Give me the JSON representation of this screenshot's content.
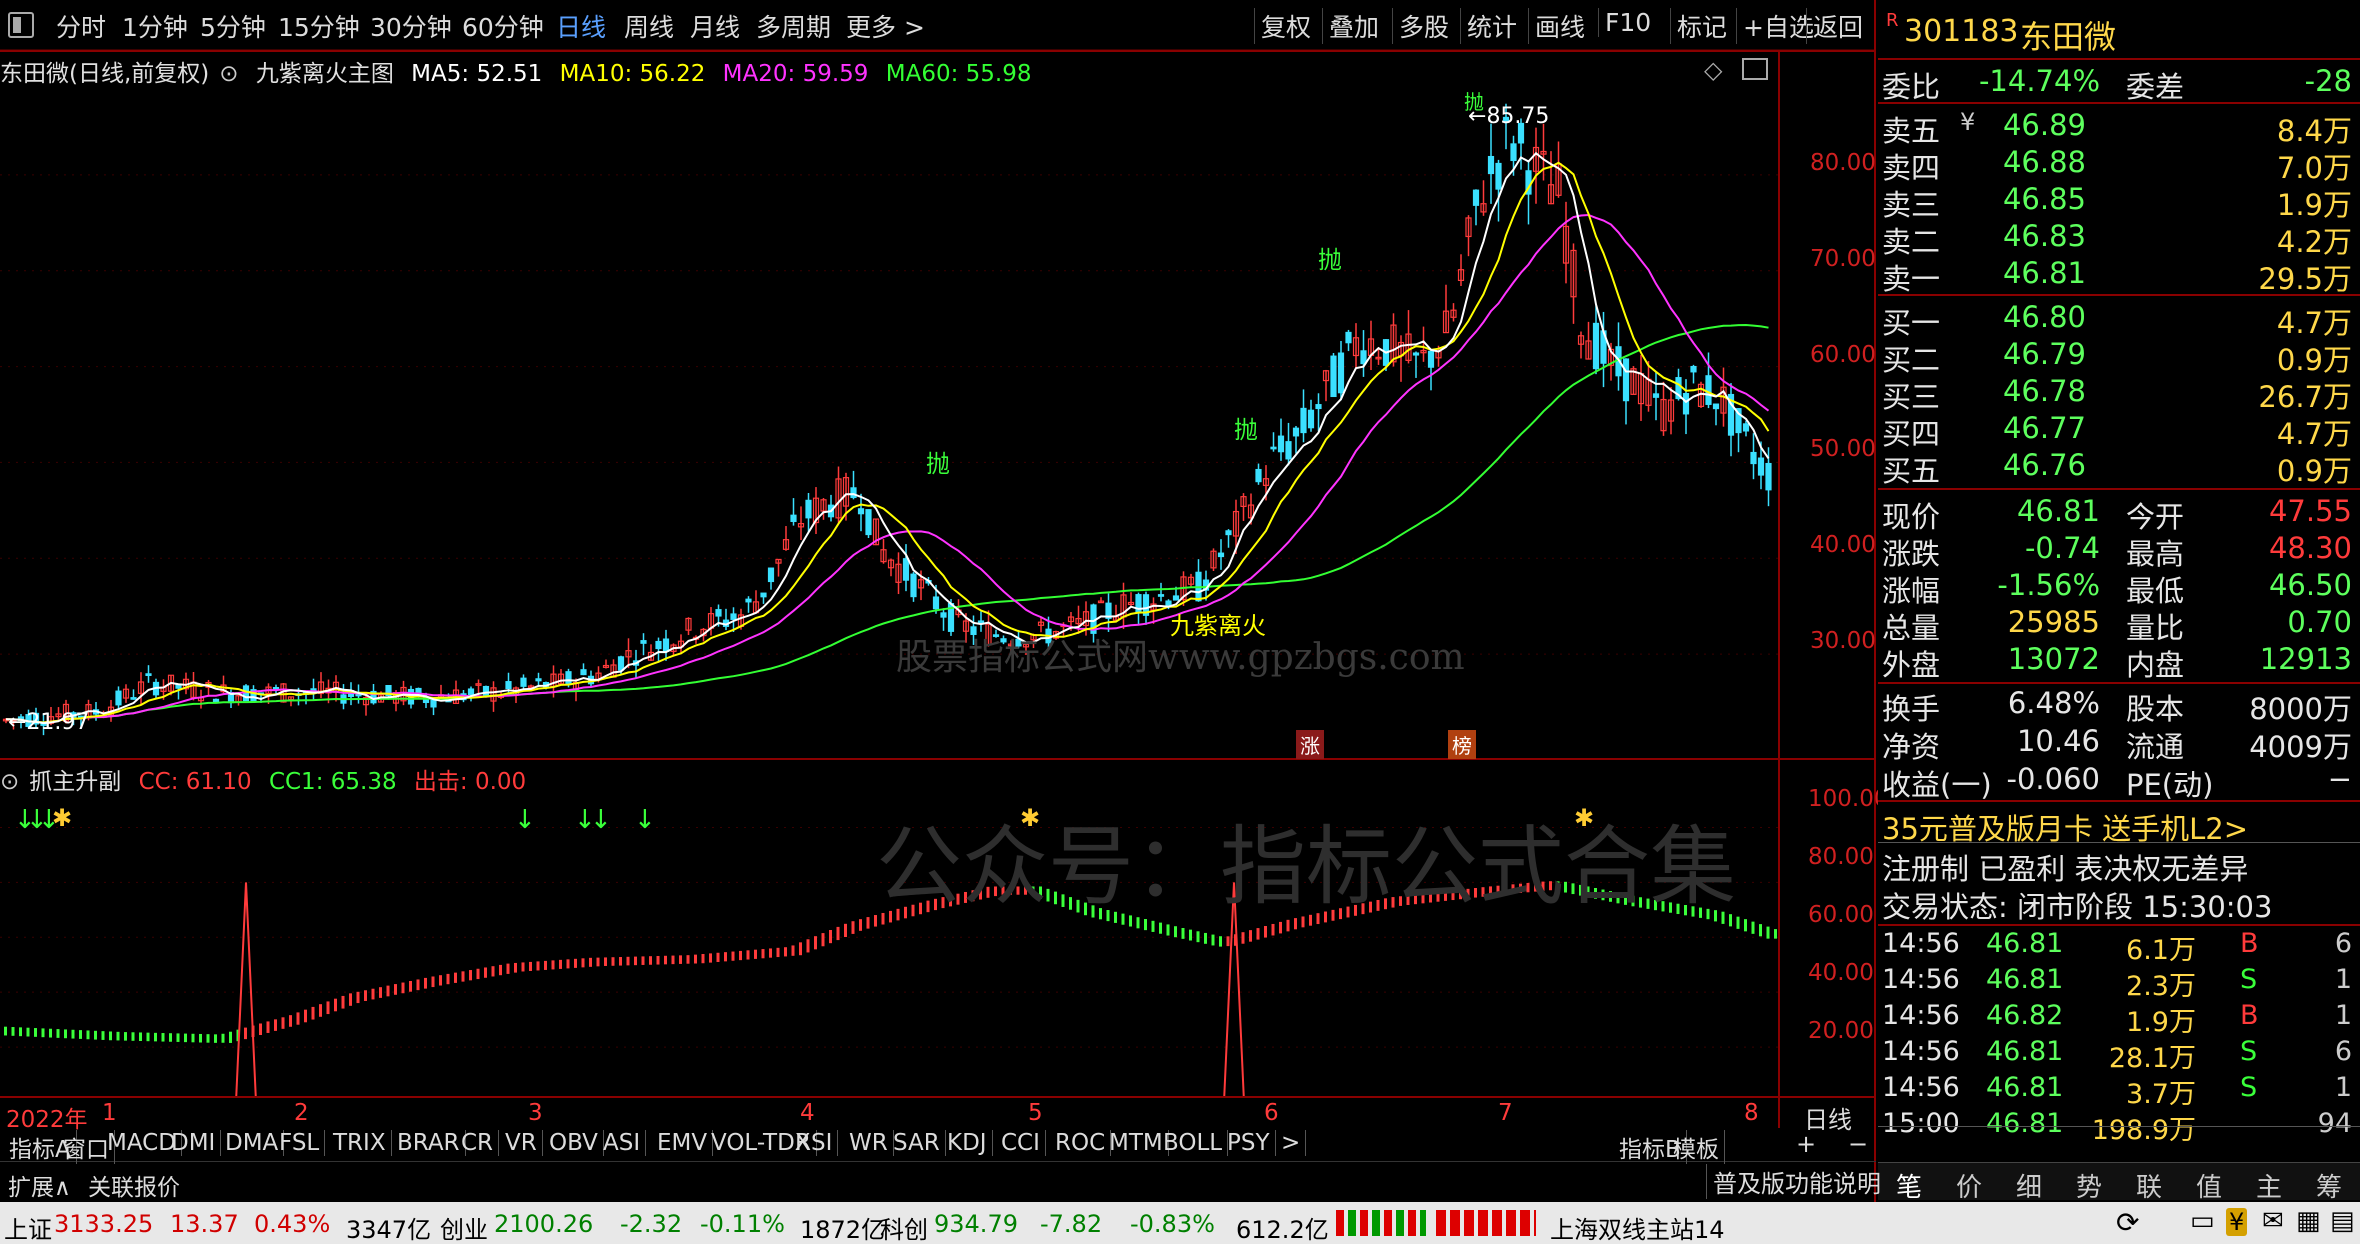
{
  "toolbar": {
    "periods": [
      "分时",
      "1分钟",
      "5分钟",
      "15分钟",
      "30分钟",
      "60分钟",
      "日线",
      "周线",
      "月线",
      "多周期",
      "更多 >"
    ],
    "active": "日线",
    "buttons": [
      "复权",
      "叠加",
      "多股",
      "统计",
      "画线",
      "F10",
      "标记",
      "+自选",
      "返回"
    ]
  },
  "main_chart": {
    "stock_label": "东田微(日线,前复权)",
    "formula_name": "九紫离火主图",
    "ma5": "MA5: 52.51",
    "ma10": "MA10: 56.22",
    "ma20": "MA20: 59.59",
    "ma60": "MA60: 55.98",
    "y_ticks": [
      "80.00",
      "70.00",
      "60.00",
      "50.00",
      "40.00",
      "30.00"
    ],
    "high_label": "85.75",
    "low_label": "21.97",
    "signal_texts": [
      "抛",
      "抛",
      "抛",
      "抛"
    ],
    "zone_text": "九紫离火",
    "watermark": "股票指标公式网www.gpzbgs.com",
    "badges": [
      "涨",
      "榜"
    ]
  },
  "sub_chart": {
    "name": "抓主升副",
    "cc": "CC: 61.10",
    "cc1": "CC1: 65.38",
    "exit": "出击: 0.00",
    "y_ticks": [
      "100.00",
      "80.00",
      "60.00",
      "40.00",
      "20.00"
    ],
    "watermark": "公众号：指标公式合集"
  },
  "x_axis": {
    "year": "2022年",
    "months": [
      "1",
      "2",
      "3",
      "4",
      "5",
      "6",
      "7",
      "8"
    ],
    "period_label": "日线",
    "plus": "+",
    "minus": "−"
  },
  "indicator_tabs": [
    "指标A",
    "窗口",
    "MACD",
    "DMI",
    "DMA",
    "FSL",
    "TRIX",
    "BRAR",
    "CR",
    "VR",
    "OBV",
    "ASI",
    "EMV",
    "VOL-TDX",
    "RSI",
    "WR",
    "SAR",
    "KDJ",
    "CCI",
    "ROC",
    "MTM",
    "BOLL",
    "PSY",
    ">",
    "指标B",
    "模板"
  ],
  "bottom_tabs": [
    "扩展∧",
    "关联报价"
  ],
  "quote": {
    "code": "301183",
    "name": "东田微",
    "r_flag": "R",
    "weibi": {
      "label": "委比",
      "value": "-14.74%",
      "label2": "委差",
      "value2": "-28"
    },
    "asks": [
      {
        "label": "卖五",
        "price": "46.89",
        "vol": "8.4万",
        "mark": "¥"
      },
      {
        "label": "卖四",
        "price": "46.88",
        "vol": "7.0万"
      },
      {
        "label": "卖三",
        "price": "46.85",
        "vol": "1.9万"
      },
      {
        "label": "卖二",
        "price": "46.83",
        "vol": "4.2万"
      },
      {
        "label": "卖一",
        "price": "46.81",
        "vol": "29.5万"
      }
    ],
    "bids": [
      {
        "label": "买一",
        "price": "46.80",
        "vol": "4.7万"
      },
      {
        "label": "买二",
        "price": "46.79",
        "vol": "0.9万"
      },
      {
        "label": "买三",
        "price": "46.78",
        "vol": "26.7万"
      },
      {
        "label": "买四",
        "price": "46.77",
        "vol": "4.7万"
      },
      {
        "label": "买五",
        "price": "46.76",
        "vol": "0.9万"
      }
    ],
    "stats": [
      [
        "现价",
        "46.81",
        "今开",
        "47.55"
      ],
      [
        "涨跌",
        "-0.74",
        "最高",
        "48.30"
      ],
      [
        "涨幅",
        "-1.56%",
        "最低",
        "46.50"
      ],
      [
        "总量",
        "25985",
        "量比",
        "0.70"
      ],
      [
        "外盘",
        "13072",
        "内盘",
        "12913"
      ]
    ],
    "stats2": [
      [
        "换手",
        "6.48%",
        "股本",
        "8000万"
      ],
      [
        "净资",
        "10.46",
        "流通",
        "4009万"
      ],
      [
        "收益(一)",
        "-0.060",
        "PE(动)",
        "−"
      ]
    ],
    "promo": "35元普及版月卡 送手机L2>",
    "tags": "注册制 已盈利 表决权无差异",
    "trade_state": "交易状态: 闭市阶段 15:30:03",
    "ticks": [
      {
        "time": "14:56",
        "price": "46.81",
        "vol": "6.1万",
        "side": "B",
        "n": "6"
      },
      {
        "time": "14:56",
        "price": "46.81",
        "vol": "2.3万",
        "side": "S",
        "n": "1"
      },
      {
        "time": "14:56",
        "price": "46.82",
        "vol": "1.9万",
        "side": "B",
        "n": "1"
      },
      {
        "time": "14:56",
        "price": "46.81",
        "vol": "28.1万",
        "side": "S",
        "n": "6"
      },
      {
        "time": "14:56",
        "price": "46.81",
        "vol": "3.7万",
        "side": "S",
        "n": "1"
      },
      {
        "time": "15:00",
        "price": "46.81",
        "vol": "198.9万",
        "side": "",
        "n": "94"
      }
    ],
    "func_label": "普及版功能说明",
    "panel_tabs": [
      "笔",
      "价",
      "细",
      "势",
      "联",
      "值",
      "主",
      "筹"
    ]
  },
  "status_bar": {
    "sh_label": "上证",
    "sh_val": "3133.25",
    "sh_chg": "13.37",
    "sh_pct": "0.43%",
    "sh_amt": "3347亿",
    "cy_label": "创业",
    "cy_val": "2100.26",
    "cy_chg": "-2.32",
    "cy_pct": "-0.11%",
    "cy_amt": "1872亿",
    "kc_label": "科创",
    "kc_val": "934.79",
    "kc_chg": "-7.82",
    "kc_pct": "-0.83%",
    "kc_amt": "612.2亿",
    "server": "上海双线主站14"
  },
  "colors": {
    "up": "#ff3b3b",
    "down": "#3aff3a",
    "ma5": "#ffffff",
    "ma10": "#ffff00",
    "ma20": "#ff33ff",
    "ma60": "#33ff33"
  },
  "chart_data": {
    "type": "line",
    "title": "东田微(日线,前复权)",
    "ylim": [
      20,
      88
    ],
    "x": [
      "1",
      "2",
      "3",
      "4",
      "5",
      "6",
      "7",
      "8"
    ],
    "series": [
      {
        "name": "close",
        "values": [
          23,
          24,
          26,
          25,
          26,
          28,
          45,
          33,
          35,
          62,
          70,
          80,
          60,
          52,
          47
        ]
      },
      {
        "name": "MA5",
        "values": [
          52.51
        ]
      },
      {
        "name": "MA10",
        "values": [
          56.22
        ]
      },
      {
        "name": "MA20",
        "values": [
          59.59
        ]
      },
      {
        "name": "MA60",
        "values": [
          55.98
        ]
      }
    ]
  }
}
